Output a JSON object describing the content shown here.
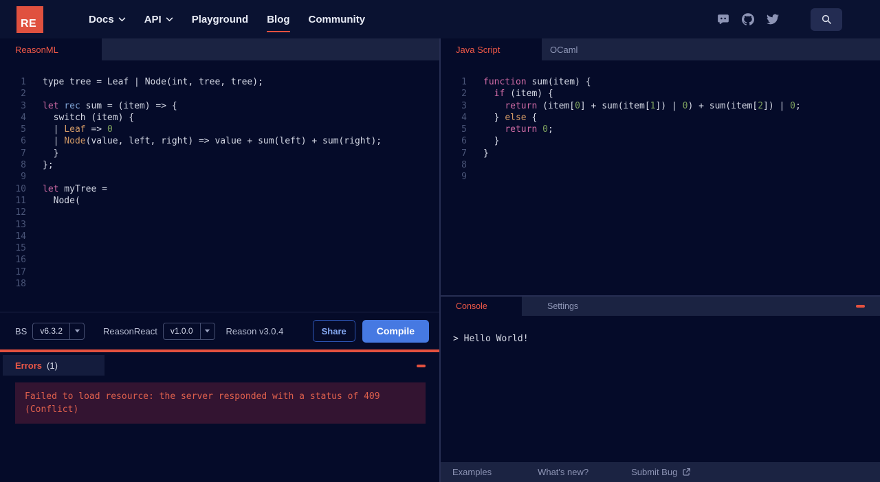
{
  "colors": {
    "accent_red": "#e4513f",
    "active_tab_red": "#ed5847",
    "compile_blue": "#4679e2",
    "share_blue": "#85a8f2",
    "editor_bg": "#050b29",
    "tabbar_bg": "#1b2342",
    "error_box_bg": "#331431",
    "error_text": "#df604d"
  },
  "nav": {
    "logo_text": "RE",
    "items": [
      {
        "label": "Docs",
        "has_dropdown": true
      },
      {
        "label": "API",
        "has_dropdown": true
      },
      {
        "label": "Playground",
        "has_dropdown": false
      },
      {
        "label": "Blog",
        "has_dropdown": false,
        "active": true
      },
      {
        "label": "Community",
        "has_dropdown": false
      }
    ],
    "icons": [
      "discord-icon",
      "github-icon",
      "twitter-icon",
      "search-icon"
    ]
  },
  "left_editor": {
    "tab_label": "ReasonML",
    "total_lines": 18,
    "lines": [
      [
        [
          "w",
          "type tree = Leaf | Node(int, tree, tree);"
        ]
      ],
      [],
      [
        [
          "p",
          "let"
        ],
        [
          "w",
          " "
        ],
        [
          "b",
          "rec"
        ],
        [
          "w",
          " sum = (item) => {"
        ]
      ],
      [
        [
          "w",
          "  switch (item) {"
        ]
      ],
      [
        [
          "w",
          "  | "
        ],
        [
          "o",
          "Leaf"
        ],
        [
          "w",
          " => "
        ],
        [
          "g",
          "0"
        ]
      ],
      [
        [
          "w",
          "  | "
        ],
        [
          "o",
          "Node"
        ],
        [
          "w",
          "(value, left, right) => value + sum(left) + sum(right);"
        ]
      ],
      [
        [
          "w",
          "  }"
        ]
      ],
      [
        [
          "w",
          "};"
        ]
      ],
      [],
      [
        [
          "p",
          "let"
        ],
        [
          "w",
          " myTree ="
        ]
      ],
      [
        [
          "w",
          "  Node("
        ]
      ]
    ]
  },
  "right_editor": {
    "tabs": [
      {
        "label": "Java Script",
        "active": true
      },
      {
        "label": "OCaml",
        "active": false
      }
    ],
    "total_lines": 9,
    "lines": [
      [
        [
          "p",
          "function"
        ],
        [
          "w",
          " sum(item) {"
        ]
      ],
      [
        [
          "w",
          "  "
        ],
        [
          "p",
          "if"
        ],
        [
          "w",
          " (item) {"
        ]
      ],
      [
        [
          "w",
          "    "
        ],
        [
          "p",
          "return"
        ],
        [
          "w",
          " (item["
        ],
        [
          "g",
          "0"
        ],
        [
          "w",
          "] + sum(item["
        ],
        [
          "g",
          "1"
        ],
        [
          "w",
          "]) | "
        ],
        [
          "g",
          "0"
        ],
        [
          "w",
          ") + sum(item["
        ],
        [
          "g",
          "2"
        ],
        [
          "w",
          "]) | "
        ],
        [
          "g",
          "0"
        ],
        [
          "w",
          ";"
        ]
      ],
      [
        [
          "w",
          "  } "
        ],
        [
          "o",
          "else"
        ],
        [
          "w",
          " {"
        ]
      ],
      [
        [
          "w",
          "    "
        ],
        [
          "p",
          "return"
        ],
        [
          "w",
          " "
        ],
        [
          "g",
          "0"
        ],
        [
          "w",
          ";"
        ]
      ],
      [
        [
          "w",
          "  }"
        ]
      ],
      [
        [
          "w",
          "}"
        ]
      ]
    ]
  },
  "toolbar": {
    "bs_label": "BS",
    "bs_version": "v6.3.2",
    "reasonreact_label": "ReasonReact",
    "reasonreact_version": "v1.0.0",
    "reason_version_text": "Reason v3.0.4",
    "share_label": "Share",
    "compile_label": "Compile"
  },
  "errors": {
    "title": "Errors",
    "count": "(1)",
    "message": "Failed to load resource: the server responded with a status of 409 (Conflict)"
  },
  "console": {
    "tabs": [
      {
        "label": "Console",
        "active": true
      },
      {
        "label": "Settings",
        "active": false
      }
    ],
    "output": "> Hello World!"
  },
  "footer": {
    "items": [
      "Examples",
      "What's new?",
      "Submit Bug"
    ]
  }
}
